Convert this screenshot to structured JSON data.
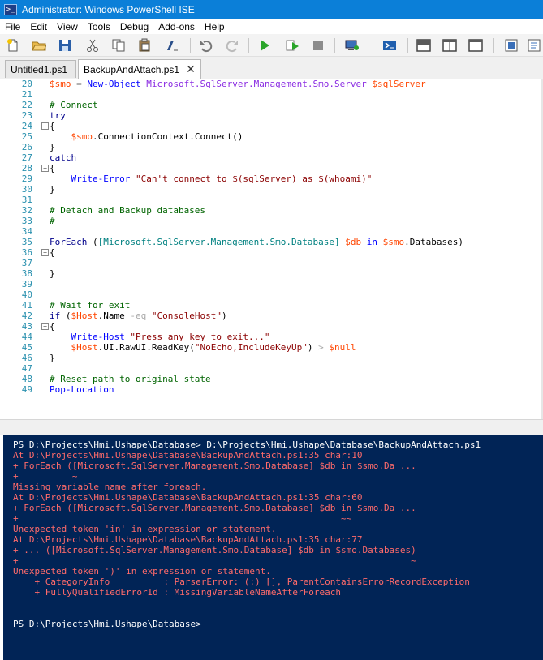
{
  "window": {
    "title": "Administrator: Windows PowerShell ISE"
  },
  "menu": [
    "File",
    "Edit",
    "View",
    "Tools",
    "Debug",
    "Add-ons",
    "Help"
  ],
  "toolbar": {
    "icons": [
      "new-icon",
      "open-icon",
      "save-icon",
      "cut-icon",
      "copy-icon",
      "paste-icon",
      "clear-console-icon",
      "undo-icon",
      "redo-icon",
      "run-icon",
      "run-selection-icon",
      "stop-icon",
      "remote-powershell-icon",
      "powershell-icon",
      "layout-top-icon",
      "layout-right-icon",
      "layout-max-icon",
      "show-addon-icon",
      "show-command-icon"
    ]
  },
  "tabs": [
    {
      "label": "Untitled1.ps1",
      "active": false
    },
    {
      "label": "BackupAndAttach.ps1",
      "active": true,
      "close": "✕"
    }
  ],
  "editor": {
    "lines": [
      {
        "n": "20",
        "fold": "",
        "seg": [
          [
            "$smo",
            "var"
          ],
          [
            " = ",
            "op"
          ],
          [
            "New-Object",
            "cmd"
          ],
          [
            " Microsoft.SqlServer.Management.Smo.Server ",
            "arg"
          ],
          [
            "$sqlServer",
            "var"
          ]
        ]
      },
      {
        "n": "21",
        "fold": "",
        "seg": []
      },
      {
        "n": "22",
        "fold": "",
        "seg": [
          [
            "# Connect",
            "comment"
          ]
        ]
      },
      {
        "n": "23",
        "fold": "",
        "seg": [
          [
            "try",
            "kw"
          ]
        ]
      },
      {
        "n": "24",
        "fold": "⊟",
        "seg": [
          [
            "{",
            "plain"
          ]
        ]
      },
      {
        "n": "25",
        "fold": "",
        "seg": [
          [
            "    ",
            "plain"
          ],
          [
            "$smo",
            "var"
          ],
          [
            ".ConnectionContext.Connect()",
            "plain"
          ]
        ]
      },
      {
        "n": "26",
        "fold": "",
        "seg": [
          [
            "}",
            "plain"
          ]
        ]
      },
      {
        "n": "27",
        "fold": "",
        "seg": [
          [
            "catch",
            "kw"
          ]
        ]
      },
      {
        "n": "28",
        "fold": "⊟",
        "seg": [
          [
            "{",
            "plain"
          ]
        ]
      },
      {
        "n": "29",
        "fold": "",
        "seg": [
          [
            "    ",
            "plain"
          ],
          [
            "Write-Error",
            "cmd"
          ],
          [
            " ",
            "plain"
          ],
          [
            "\"Can't connect to $(sqlServer) as $(whoami)\"",
            "str"
          ]
        ]
      },
      {
        "n": "30",
        "fold": "",
        "seg": [
          [
            "}",
            "plain"
          ]
        ]
      },
      {
        "n": "31",
        "fold": "",
        "seg": []
      },
      {
        "n": "32",
        "fold": "",
        "seg": [
          [
            "# Detach and Backup databases",
            "comment"
          ]
        ]
      },
      {
        "n": "33",
        "fold": "",
        "seg": [
          [
            "#",
            "comment"
          ]
        ]
      },
      {
        "n": "34",
        "fold": "",
        "seg": []
      },
      {
        "n": "35",
        "fold": "",
        "seg": [
          [
            "ForEach",
            "kw"
          ],
          [
            " (",
            "plain"
          ],
          [
            "[Microsoft.SqlServer.Management.Smo.Database]",
            "type"
          ],
          [
            " ",
            "plain"
          ],
          [
            "$db",
            "var"
          ],
          [
            " ",
            "plain"
          ],
          [
            "in",
            "cmd"
          ],
          [
            " ",
            "plain"
          ],
          [
            "$smo",
            "var"
          ],
          [
            ".Databases)",
            "plain"
          ]
        ]
      },
      {
        "n": "36",
        "fold": "⊟",
        "seg": [
          [
            "{",
            "plain"
          ]
        ]
      },
      {
        "n": "37",
        "fold": "",
        "seg": []
      },
      {
        "n": "38",
        "fold": "",
        "seg": [
          [
            "}",
            "plain"
          ]
        ]
      },
      {
        "n": "39",
        "fold": "",
        "seg": []
      },
      {
        "n": "40",
        "fold": "",
        "seg": []
      },
      {
        "n": "41",
        "fold": "",
        "seg": [
          [
            "# Wait for exit",
            "comment"
          ]
        ]
      },
      {
        "n": "42",
        "fold": "",
        "seg": [
          [
            "if",
            "kw"
          ],
          [
            " (",
            "plain"
          ],
          [
            "$Host",
            "var"
          ],
          [
            ".Name ",
            "plain"
          ],
          [
            "-eq",
            "op"
          ],
          [
            " ",
            "plain"
          ],
          [
            "\"ConsoleHost\"",
            "str"
          ],
          [
            ")",
            "plain"
          ]
        ]
      },
      {
        "n": "43",
        "fold": "⊟",
        "seg": [
          [
            "{",
            "plain"
          ]
        ]
      },
      {
        "n": "44",
        "fold": "",
        "seg": [
          [
            "    ",
            "plain"
          ],
          [
            "Write-Host",
            "cmd"
          ],
          [
            " ",
            "plain"
          ],
          [
            "\"Press any key to exit...\"",
            "str"
          ]
        ]
      },
      {
        "n": "45",
        "fold": "",
        "seg": [
          [
            "    ",
            "plain"
          ],
          [
            "$Host",
            "var"
          ],
          [
            ".UI.RawUI.ReadKey(",
            "plain"
          ],
          [
            "\"NoEcho,IncludeKeyUp\"",
            "str"
          ],
          [
            ") ",
            "plain"
          ],
          [
            "> ",
            "op"
          ],
          [
            "$null",
            "var"
          ]
        ]
      },
      {
        "n": "46",
        "fold": "",
        "seg": [
          [
            "}",
            "plain"
          ]
        ]
      },
      {
        "n": "47",
        "fold": "",
        "seg": []
      },
      {
        "n": "48",
        "fold": "",
        "seg": [
          [
            "# Reset path to original state",
            "comment"
          ]
        ]
      },
      {
        "n": "49",
        "fold": "",
        "seg": [
          [
            "Pop-Location",
            "cmd"
          ]
        ]
      }
    ]
  },
  "console": {
    "lines": [
      {
        "t": "PS D:\\Projects\\Hmi.Ushape\\Database> D:\\Projects\\Hmi.Ushape\\Database\\BackupAndAttach.ps1",
        "c": "white"
      },
      {
        "t": "At D:\\Projects\\Hmi.Ushape\\Database\\BackupAndAttach.ps1:35 char:10",
        "c": "red"
      },
      {
        "t": "+ ForEach ([Microsoft.SqlServer.Management.Smo.Database] $db in $smo.Da ...",
        "c": "red"
      },
      {
        "t": "+          ~",
        "c": "red"
      },
      {
        "t": "Missing variable name after foreach.",
        "c": "red"
      },
      {
        "t": "At D:\\Projects\\Hmi.Ushape\\Database\\BackupAndAttach.ps1:35 char:60",
        "c": "red"
      },
      {
        "t": "+ ForEach ([Microsoft.SqlServer.Management.Smo.Database] $db in $smo.Da ...",
        "c": "red"
      },
      {
        "t": "+                                                            ~~",
        "c": "red"
      },
      {
        "t": "Unexpected token 'in' in expression or statement.",
        "c": "red"
      },
      {
        "t": "At D:\\Projects\\Hmi.Ushape\\Database\\BackupAndAttach.ps1:35 char:77",
        "c": "red"
      },
      {
        "t": "+ ... ([Microsoft.SqlServer.Management.Smo.Database] $db in $smo.Databases)",
        "c": "red"
      },
      {
        "t": "+                                                                         ~",
        "c": "red"
      },
      {
        "t": "Unexpected token ')' in expression or statement.",
        "c": "red"
      },
      {
        "t": "    + CategoryInfo          : ParserError: (:) [], ParentContainsErrorRecordException",
        "c": "red"
      },
      {
        "t": "    + FullyQualifiedErrorId : MissingVariableNameAfterForeach",
        "c": "red"
      },
      {
        "t": "",
        "c": "white"
      },
      {
        "t": "",
        "c": "white"
      },
      {
        "t": "PS D:\\Projects\\Hmi.Ushape\\Database>",
        "c": "white"
      }
    ]
  },
  "colors": {
    "titlebar": "#0b7fd8",
    "console_bg": "#012456",
    "comment": "#006400",
    "keyword": "#00008b",
    "variable": "#ff4500",
    "command": "#0000ff",
    "string": "#8b0000",
    "type": "#008080",
    "operator": "#a9a9a9",
    "argument": "#8a2be2",
    "error": "#ff6b6b"
  }
}
